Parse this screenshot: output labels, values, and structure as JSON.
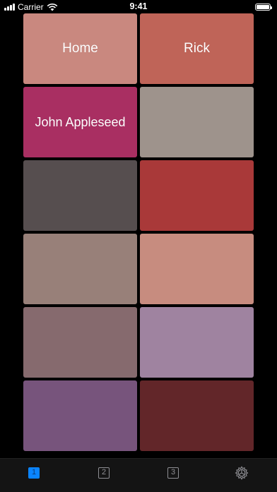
{
  "status_bar": {
    "carrier": "Carrier",
    "time": "9:41"
  },
  "tiles": [
    {
      "label": "Home",
      "color": "#C9887F"
    },
    {
      "label": "Rick",
      "color": "#BF6458"
    },
    {
      "label": "John Appleseed",
      "color": "#A92F62"
    },
    {
      "label": "",
      "color": "#9E938C"
    },
    {
      "label": "",
      "color": "#564E4F"
    },
    {
      "label": "",
      "color": "#A93939"
    },
    {
      "label": "",
      "color": "#988079"
    },
    {
      "label": "",
      "color": "#C78C7F"
    },
    {
      "label": "",
      "color": "#866A6E"
    },
    {
      "label": "",
      "color": "#9F83A0"
    },
    {
      "label": "",
      "color": "#77547C"
    },
    {
      "label": "",
      "color": "#622629"
    }
  ],
  "tabbar": {
    "accent": "#0A84FF",
    "tabs": [
      {
        "label": "1",
        "icon": "square-1-icon",
        "active": true
      },
      {
        "label": "2",
        "icon": "square-2-icon",
        "active": false
      },
      {
        "label": "3",
        "icon": "square-3-icon",
        "active": false
      },
      {
        "label": "",
        "icon": "settings-gear-icon",
        "active": false
      }
    ]
  }
}
